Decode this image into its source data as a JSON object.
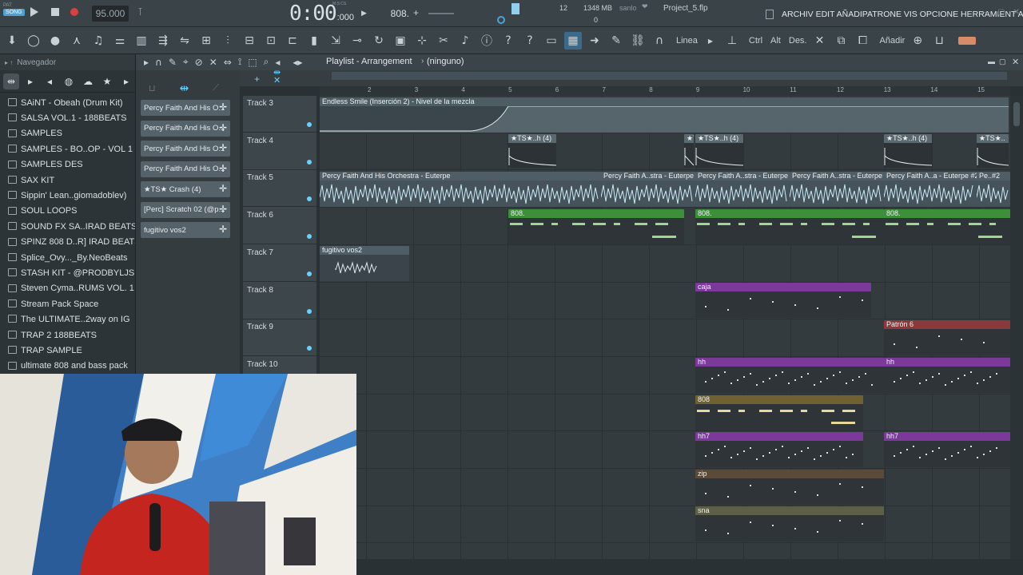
{
  "topbar": {
    "song_tag": "SONG",
    "pat_tag": "PAT",
    "tempo": "95.000",
    "time": "0:00",
    "time_ms": ":000",
    "time_label": "M:S:CS",
    "pattern": "808.",
    "cpu": "12",
    "memory": "1348 MB",
    "poly": "0",
    "user": "sanlo",
    "project": "Project_5.flp",
    "menu": "ARCHIV EDIT AÑADIPATRONE VIS OPCIONE HERRAMIENT A"
  },
  "toolbar": {
    "snap_mode": "Linea",
    "keys": [
      "Ctrl",
      "Alt",
      "Des."
    ],
    "add_label": "Añadir"
  },
  "browser": {
    "title": "Navegador",
    "items": [
      "SAiNT - Obeah (Drum Kit)",
      "SALSA VOL.1 - 188BEATS",
      "SAMPLES",
      "SAMPLES - BO..OP - VOL 1",
      "SAMPLES DES",
      "SAX KIT",
      "Sippin' Lean..giomadoblev)",
      "SOUL LOOPS",
      "SOUND FX SA..IRAD BEATS",
      "SPINZ 808 D..R] IRAD BEATS",
      "Splice_Ovy..._By.NeoBeats",
      "STASH KIT - @PRODBYLJS",
      "Steven Cyma..RUMS VOL. 1",
      "Stream Pack Space",
      "The ULTIMATE..2way on IG",
      "TRAP 2 188BEATS",
      "TRAP SAMPLE",
      "ultimate 808 and bass pack"
    ]
  },
  "picker": {
    "items": [
      "Percy Faith And His O...",
      "Percy Faith And His O...",
      "Percy Faith And His O...",
      "Percy Faith And His O...",
      "★TS★ Crash (4)",
      "[Perc] Scratch 02 (@p...",
      "fugitivo vos2"
    ]
  },
  "playlist": {
    "title": "Playlist - Arrangement",
    "selection": "(ninguno)",
    "ruler": [
      "2",
      "3",
      "4",
      "5",
      "6",
      "7",
      "8",
      "9",
      "10",
      "11",
      "12",
      "13",
      "14",
      "15"
    ],
    "tracks": [
      "Track 3",
      "Track 4",
      "Track 5",
      "Track 6",
      "Track 7",
      "Track 8",
      "Track 9",
      "Track 10"
    ],
    "clip_titles": {
      "automation": "Endless Smile (Inserción 2) - Nivel de la mezcla",
      "ts1": "★TS★..h (4)",
      "ts2": "★TS★..h (4)",
      "ts3": "★TS★..h (4)",
      "ts4": "★TS★..",
      "percy1": "Percy Faith And His Orchestra - Euterpe",
      "percy2": "Percy Faith A..stra - Euterpe",
      "percy3": "Percy Faith A..stra - Euterpe",
      "percy4": "Percy Faith A..stra - Euterpe",
      "percy5": "Percy Faith A..a - Euterpe #2",
      "percy6": "Pe..#2",
      "p808a": "808.",
      "p808b": "808.",
      "p808c": "808.",
      "fug": "fugitivo vos2",
      "caja": "caja",
      "patron6": "Patrón 6",
      "hh1": "hh",
      "hh2": "hh",
      "p808d": "808",
      "hh7a": "hh7",
      "hh7b": "hh7",
      "zip": "zip",
      "sna": "sna"
    }
  },
  "colors": {
    "accent": "#4da3d6",
    "green_clip": "#3d8f3a",
    "purple_clip": "#7b3a9a",
    "red_clip": "#8a3a3a",
    "brown_clip": "#5a4a3a",
    "gold_clip": "#6f6130",
    "olive_clip": "#5d6047"
  }
}
